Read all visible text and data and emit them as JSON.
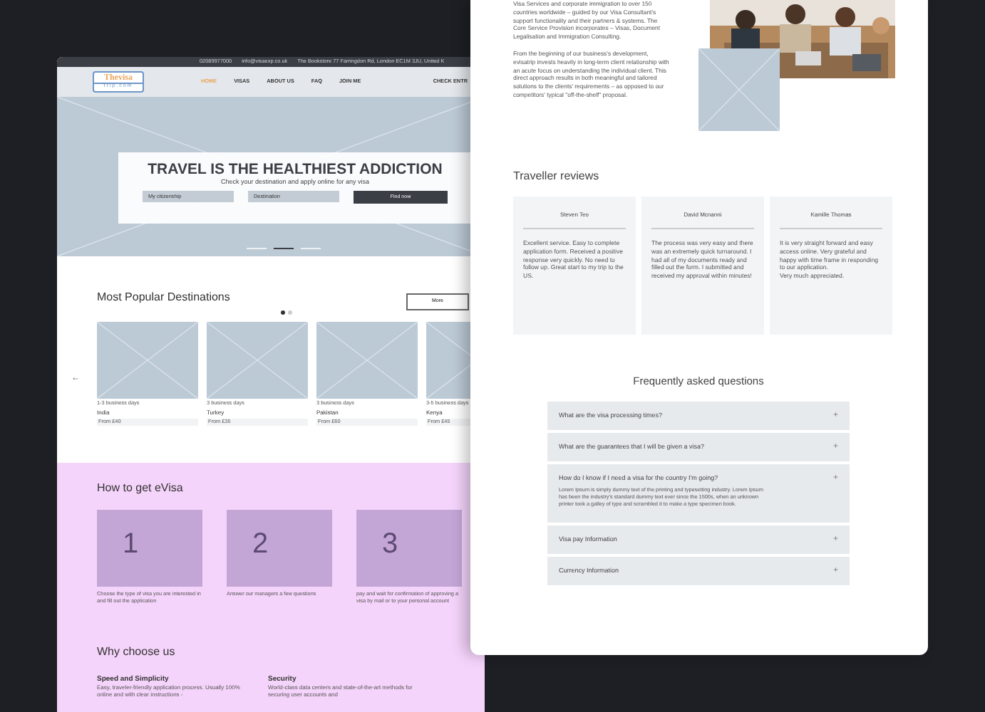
{
  "left_page": {
    "top_bar": [
      "02089977000",
      "info@visaexp.co.uk",
      "The Bookstore 77 Farringdon Rd, London EC1M 3JU, United K"
    ],
    "logo": {
      "line_1": "Thevisa",
      "line_2": "trip.com"
    },
    "nav": [
      {
        "label": "HOME",
        "selected": true
      },
      {
        "label": "VISAS",
        "selected": false
      },
      {
        "label": "ABOUT US",
        "selected": false
      },
      {
        "label": "FAQ",
        "selected": false
      },
      {
        "label": "JOIN ME",
        "selected": false
      }
    ],
    "nav_action": "CHECK ENTR",
    "hero": {
      "title": "TRAVEL IS THE HEALTHIEST ADDICTION",
      "subtitle": "Check your destination and apply online for any visa",
      "fields": [
        {
          "placeholder": "My citizenship"
        },
        {
          "placeholder": "Destination"
        }
      ],
      "button": "Find now",
      "slides": [
        {
          "selected": false
        },
        {
          "selected": true
        },
        {
          "selected": false
        }
      ]
    },
    "destinations": {
      "title": "Most Popular Destinations",
      "more": "More",
      "prev": "←",
      "pages": [
        {
          "selected": true
        },
        {
          "selected": false
        }
      ],
      "cards": [
        {
          "time": "1-3 business days",
          "country": "India",
          "price": "From £40"
        },
        {
          "time": "3 business days",
          "country": "Turkey",
          "price": "From £35"
        },
        {
          "time": "3 business days",
          "country": "Pakistan",
          "price": "From £60"
        },
        {
          "time": "3-5 business days",
          "country": "Kenya",
          "price": "From £45"
        }
      ]
    },
    "how_to": {
      "title": "How to get eVisa",
      "steps": [
        {
          "number": "1",
          "text": "Choose the type of visa you are interested in and fill out the application"
        },
        {
          "number": "2",
          "text": "Answer our managers a few questions"
        },
        {
          "number": "3",
          "text": "pay and wait for confirmation of approving a visa by mail or to your personal account"
        }
      ]
    },
    "why": {
      "title": "Why choose us",
      "features": [
        {
          "title": "Speed and Simplicity",
          "text": "Easy, traveler-friendly application process. Usually 100% online and with clear instructions -"
        },
        {
          "title": "Security",
          "text": "World-class data centers and state-of-the-art methods for securing user accounts and"
        }
      ]
    }
  },
  "right_page": {
    "about": {
      "paragraphs": [
        "Visa Services and corporate immigration to over 150 countries worldwide – guided by our Visa Consultant's support functionality and their partners & systems. The Core Service Provision incorporates – Visas, Document Legalisation and Immigration Consulting.",
        "From the beginning of our business's development, evisatrip invests heavily in long-term client relationship with an acute focus on understanding the individual client. This direct approach results in both meaningful and tailored solutions to the clients' requirements – as opposed to our competitors' typical \"off-the-shelf\" proposal."
      ]
    },
    "reviews": {
      "title": "Traveller reviews",
      "items": [
        {
          "name": "Steven Teo",
          "text": "Excellent service. Easy to complete application form. Received a positive response very quickly. No need to follow up. Great start to my trip to the US."
        },
        {
          "name": "David Mcnanni",
          "text": "The process was very easy and there was an extremely quick turnaround. I had all of my documents ready and filled out the form. I submitted and received my approval within minutes!"
        },
        {
          "name": "Kamille Thomas",
          "text": "It is very straight forward and easy access online. Very grateful and happy with time frame in responding to our application.\nVery much appreciated."
        }
      ]
    },
    "faq": {
      "title": "Frequently asked questions",
      "items": [
        {
          "question": "What are the visa processing times?",
          "icon": "+",
          "expanded": false
        },
        {
          "question": "What are the guarantees that I will be given a visa?",
          "icon": "+",
          "expanded": false
        },
        {
          "question": "How do I know if I need a visa for the country I'm going?",
          "icon": "+",
          "expanded": true,
          "answer": "Lorem Ipsum is simply dummy text of the printing and typesetting industry. Lorem Ipsum has been the industry's standard dummy text ever since the 1500s, when an unknown printer took a galley of type and scrambled it to make a type specimen book."
        },
        {
          "question": "Visa pay Information",
          "icon": "+",
          "expanded": false
        },
        {
          "question": "Currency Information",
          "icon": "+",
          "expanded": false
        }
      ]
    }
  }
}
